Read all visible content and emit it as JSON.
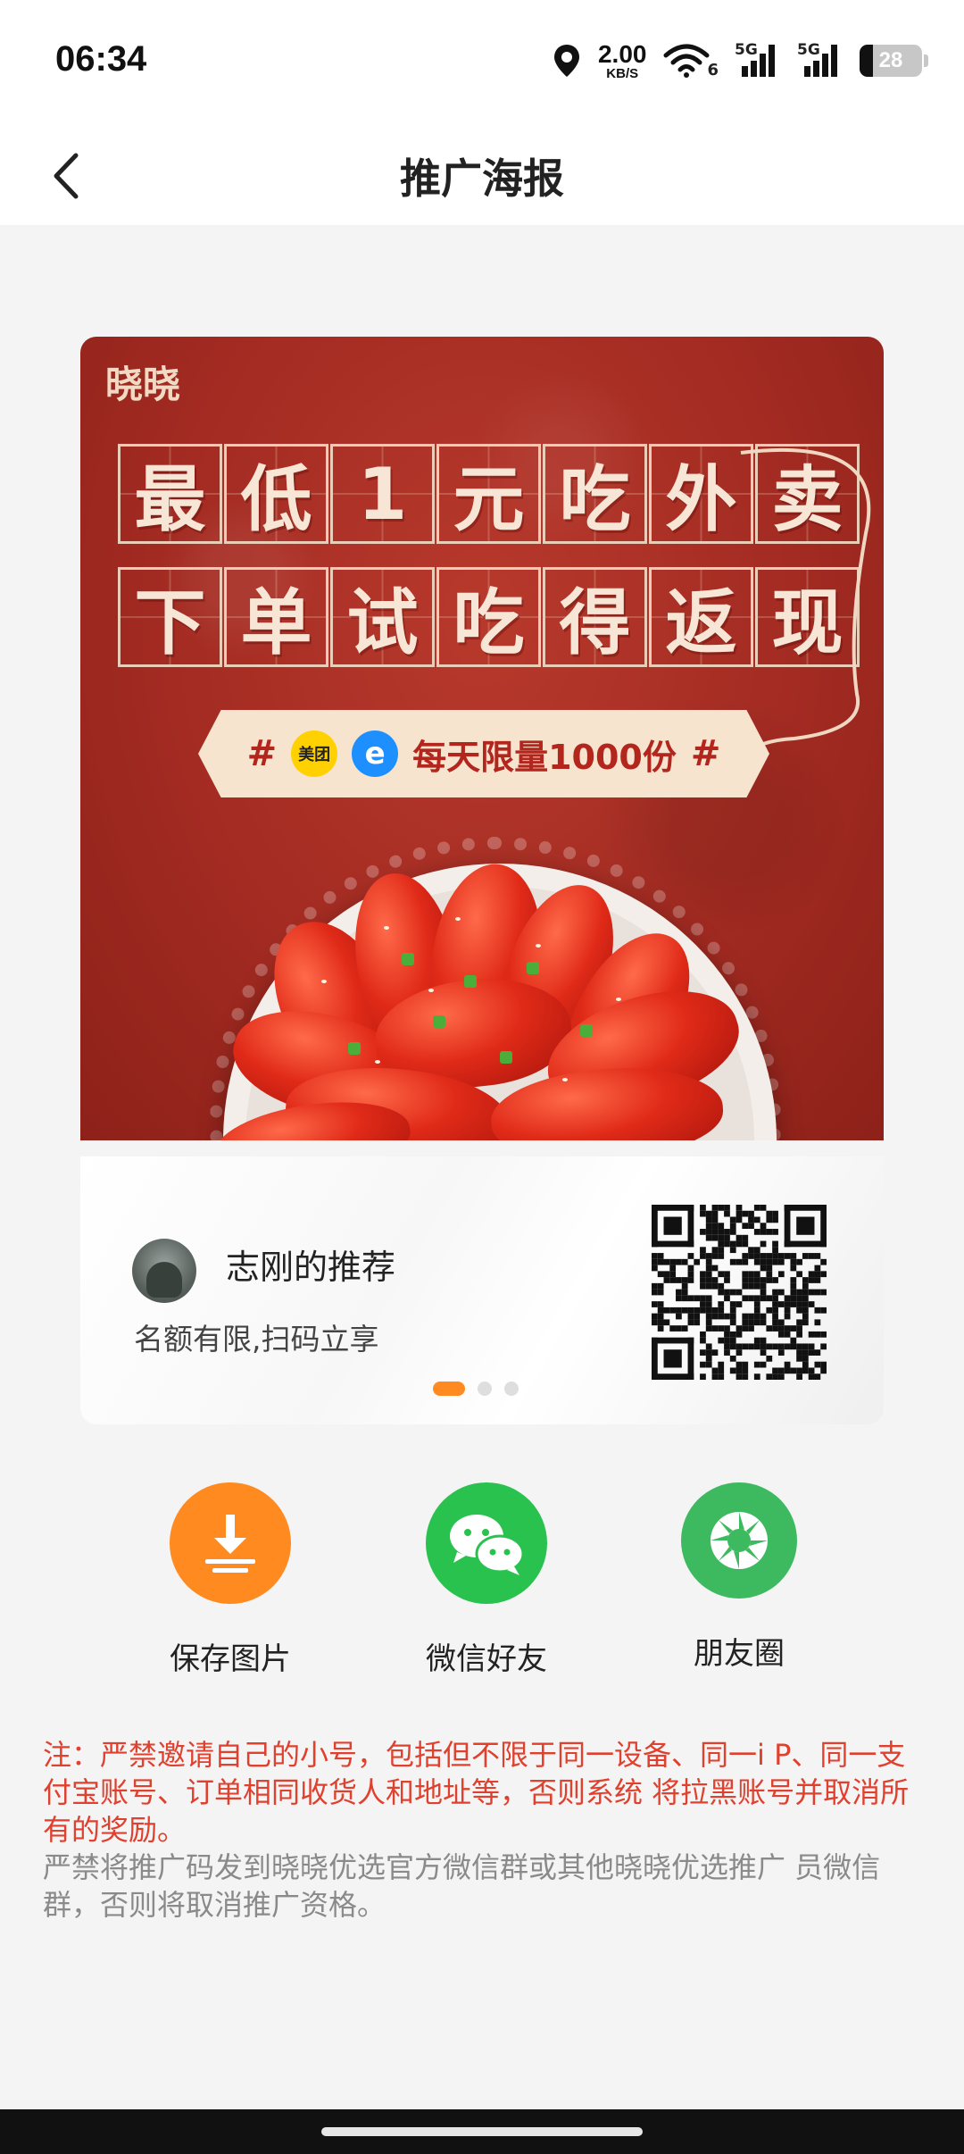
{
  "status_bar": {
    "time": "06:34",
    "net_speed_value": "2.00",
    "net_speed_unit": "KB/S",
    "wifi_label": "6",
    "signal_1_label": "5G",
    "signal_2_label": "5G",
    "battery": "28",
    "icons": [
      "location-icon",
      "wifi-icon",
      "signal-icon",
      "signal-icon",
      "battery-icon"
    ]
  },
  "nav": {
    "back_icon": "chevron-left-icon",
    "title": "推广海报"
  },
  "poster": {
    "brand": "晓晓",
    "line1": [
      "最",
      "低",
      "1",
      "元",
      "吃",
      "外",
      "卖"
    ],
    "line2": [
      "下",
      "单",
      "试",
      "吃",
      "得",
      "返",
      "现"
    ],
    "badge": {
      "hash_left": "#",
      "meituan_logo": "美团",
      "eleme_logo": "e",
      "text": "每天限量1000份",
      "hash_right": "#"
    }
  },
  "info_card": {
    "referrer_name": "志刚的推荐",
    "subtitle": "名额有限,扫码立享",
    "carousel": {
      "count": 3,
      "active_index": 0
    }
  },
  "share": {
    "items": [
      {
        "label": "保存图片",
        "icon": "download-icon",
        "color": "#ff8a1f"
      },
      {
        "label": "微信好友",
        "icon": "wechat-icon",
        "color": "#2ac24f"
      },
      {
        "label": "朋友圈",
        "icon": "moments-icon",
        "color": "#3dba5f"
      }
    ]
  },
  "notice": {
    "warning": "注：严禁邀请自己的小号，包括但不限于同一设备、同一i P、同一支付宝账号、订单相同收货人和地址等，否则系统 将拉黑账号并取消所有的奖励。",
    "info": "严禁将推广码发到晓晓优选官方微信群或其他晓晓优选推广 员微信群，否则将取消推广资格。"
  },
  "colors": {
    "accent": "#ff8a1f",
    "wechat": "#2ac24f",
    "warning": "#e0402e",
    "poster_red": "#a32b22"
  }
}
